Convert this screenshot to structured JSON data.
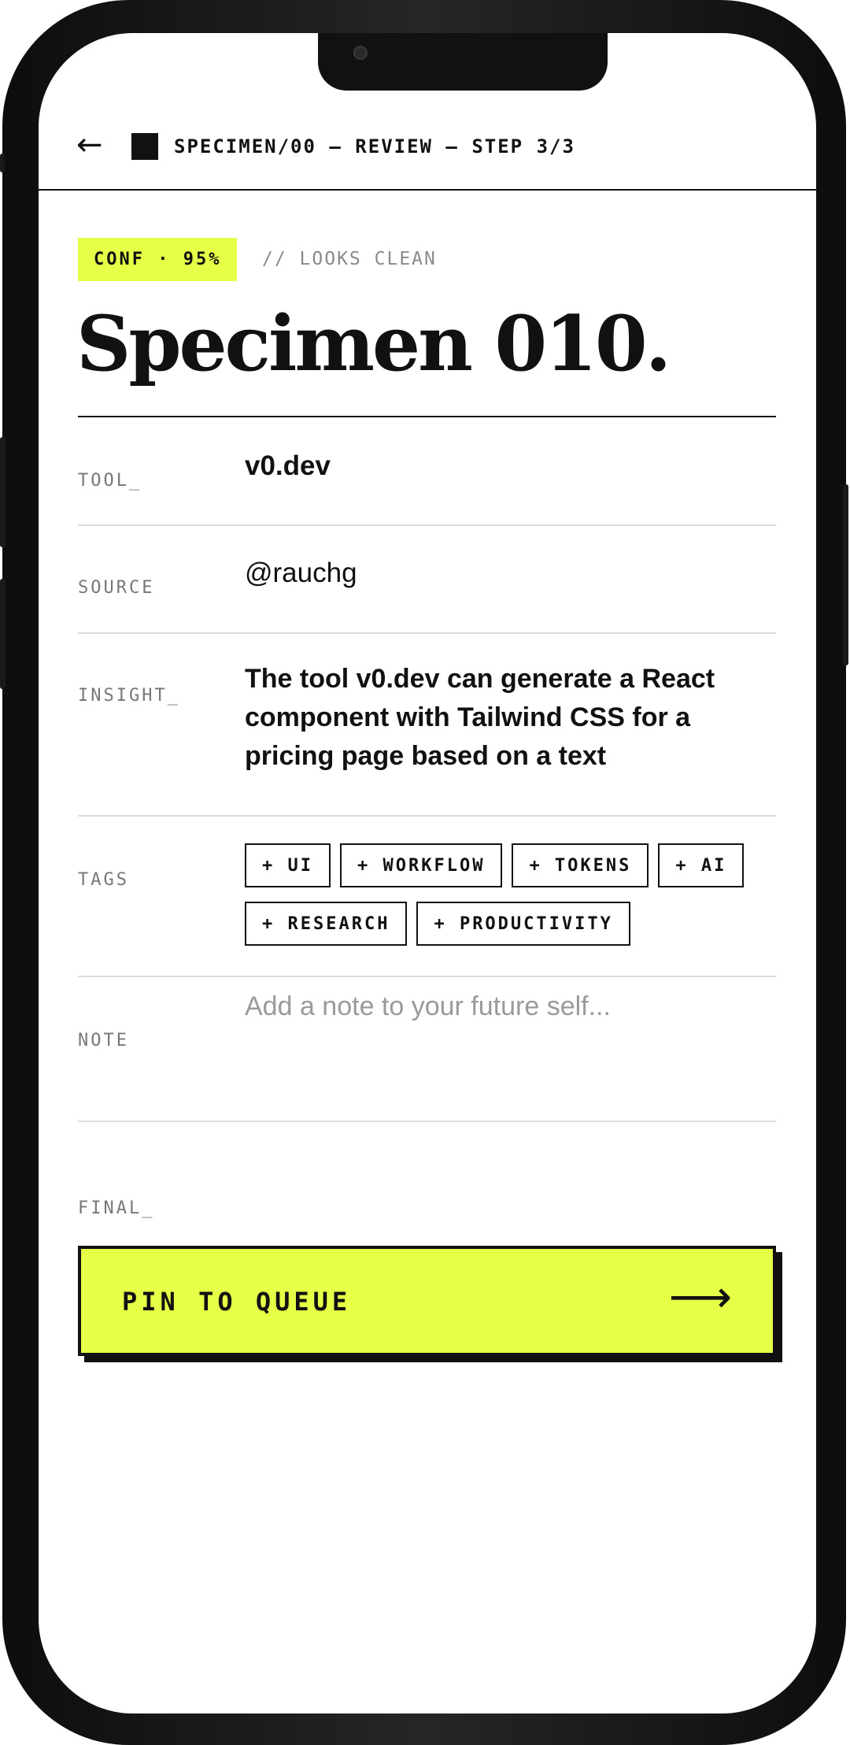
{
  "header": {
    "back_icon": "←",
    "breadcrumb": "SPECIMEN/00 — REVIEW — STEP 3/3"
  },
  "confidence": {
    "badge": "CONF · 95%",
    "note": "// LOOKS CLEAN"
  },
  "title": "Specimen 010.",
  "fields": {
    "tool": {
      "label": "TOOL_",
      "value": "v0.dev"
    },
    "source": {
      "label": "SOURCE",
      "value": "@rauchg"
    },
    "insight": {
      "label": "INSIGHT_",
      "value": "The tool v0.dev can generate a React component with Tailwind CSS for a pricing page based on a text"
    },
    "tags": {
      "label": "TAGS",
      "items": [
        "+ UI",
        "+ WORKFLOW",
        "+ TOKENS",
        "+ AI",
        "+ RESEARCH",
        "+ PRODUCTIVITY"
      ]
    },
    "note": {
      "label": "NOTE",
      "placeholder": "Add a note to your future self..."
    }
  },
  "final": {
    "label": "FINAL_",
    "button_label": "PIN TO QUEUE",
    "button_icon": "⟶"
  },
  "colors": {
    "accent": "#e6ff47",
    "ink": "#111111",
    "muted": "#8a8a8a"
  }
}
